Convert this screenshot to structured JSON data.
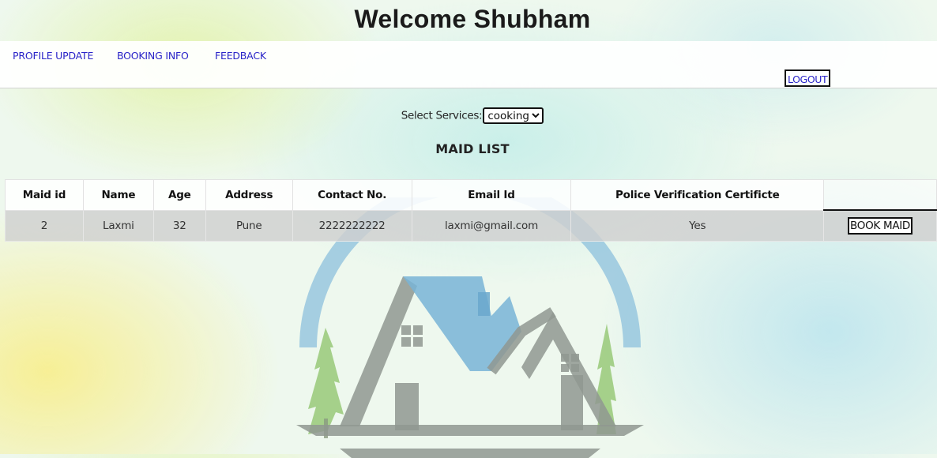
{
  "header": {
    "title": "Welcome Shubham"
  },
  "nav": {
    "items": [
      {
        "label": "PROFILE UPDATE"
      },
      {
        "label": "BOOKING INFO"
      },
      {
        "label": "FEEDBACK"
      }
    ],
    "logout_label": "LOGOUT"
  },
  "filter": {
    "label": "Select Services:",
    "selected": "cooking"
  },
  "list": {
    "title": "MAID LIST",
    "columns": [
      "Maid id",
      "Name",
      "Age",
      "Address",
      "Contact No.",
      "Email Id",
      "Police Verification Certificte",
      ""
    ],
    "rows": [
      {
        "id": "2",
        "name": "Laxmi",
        "age": "32",
        "address": "Pune",
        "contact": "2222222222",
        "email": "laxmi@gmail.com",
        "police_verification": "Yes",
        "action_label": "BOOK MAID"
      }
    ]
  },
  "icons": {
    "logo": "house-logo-icon",
    "select_arrow": "chevron-down-icon"
  },
  "colors": {
    "link": "#2a24c8",
    "logo_blue": "#7ab8d8",
    "logo_gray": "#8f9890",
    "logo_green": "#8fc46a"
  }
}
